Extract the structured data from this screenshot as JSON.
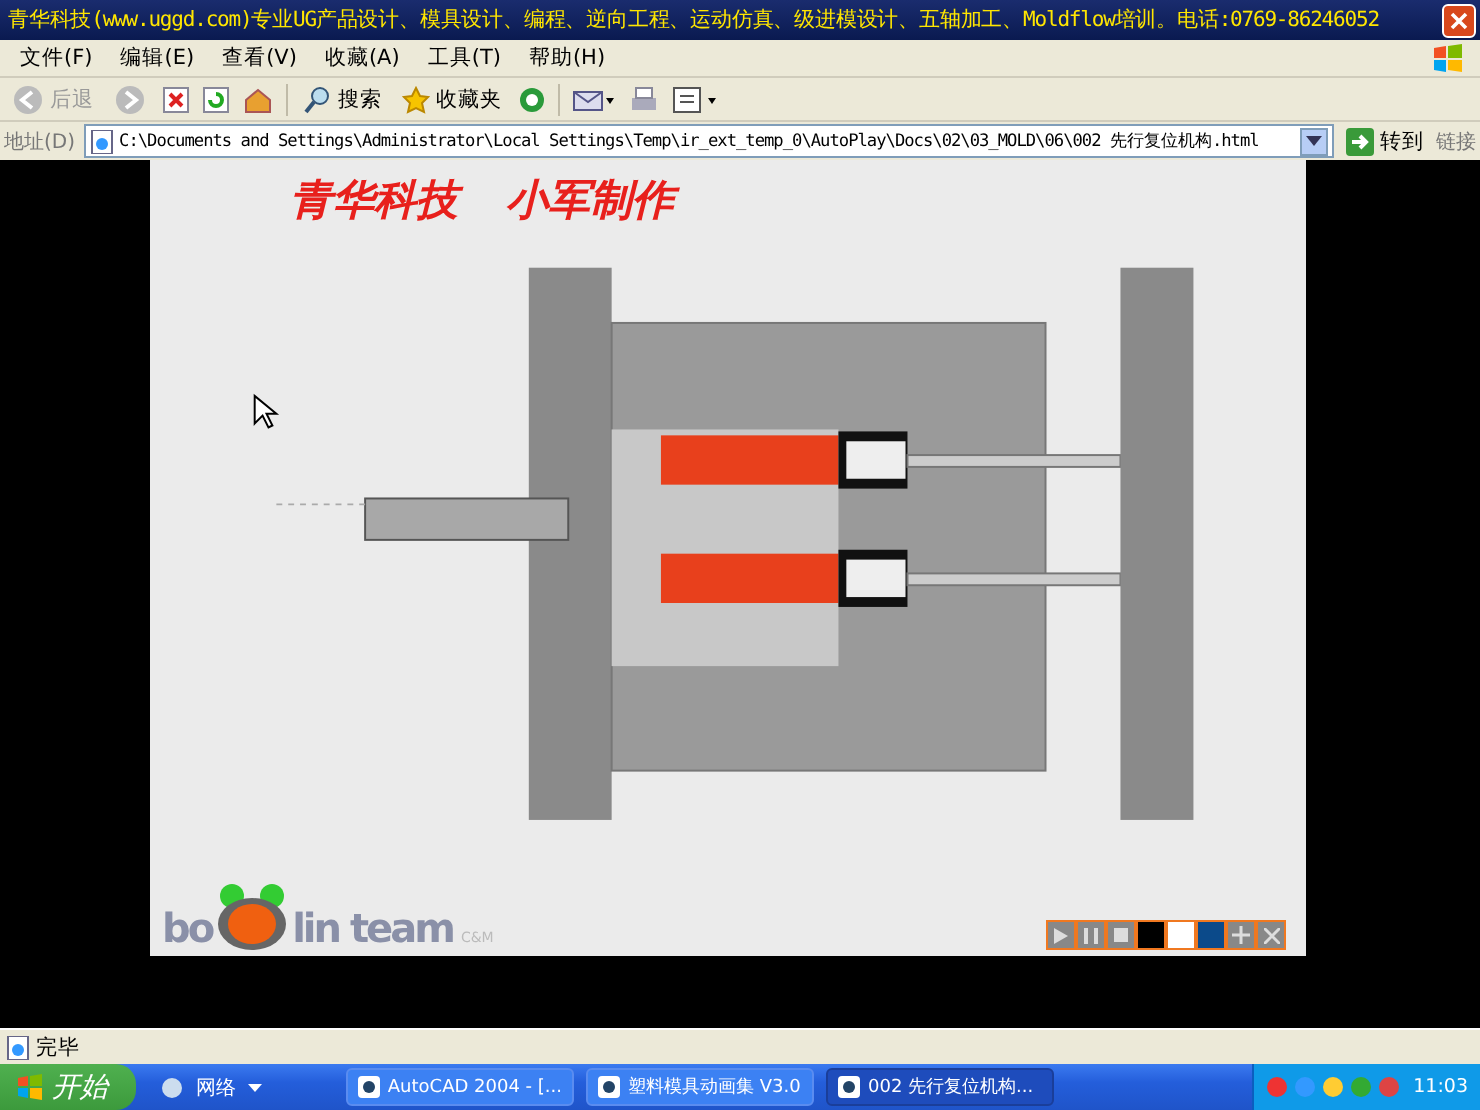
{
  "window": {
    "title": "青华科技(www.uggd.com)专业UG产品设计、模具设计、编程、逆向工程、运动仿真、级进模设计、五轴加工、Moldflow培训。电话:0769-86246052"
  },
  "menu": [
    "文件(F)",
    "编辑(E)",
    "查看(V)",
    "收藏(A)",
    "工具(T)",
    "帮助(H)"
  ],
  "toolbar": {
    "back": "后退",
    "search": "搜索",
    "favorites": "收藏夹"
  },
  "address": {
    "label": "地址(D)",
    "value": "C:\\Documents and Settings\\Administrator\\Local Settings\\Temp\\ir_ext_temp_0\\AutoPlay\\Docs\\02\\03_MOLD\\06\\002 先行复位机构.html",
    "go": "转到",
    "links": "链接"
  },
  "stage": {
    "titles": [
      "青华科技",
      "小军制作"
    ],
    "logo": {
      "left": "bo",
      "right": "lin team",
      "tag": "C&M"
    }
  },
  "status_bar": {
    "text": "完毕"
  },
  "taskbar": {
    "start": "开始",
    "quick_launch": "网络",
    "tasks": [
      {
        "label": "AutoCAD 2004 - [...",
        "selected": false
      },
      {
        "label": "塑料模具动画集 V3.0",
        "selected": false
      },
      {
        "label": "002 先行复位机构...",
        "selected": true
      }
    ],
    "clock": "11:03"
  }
}
